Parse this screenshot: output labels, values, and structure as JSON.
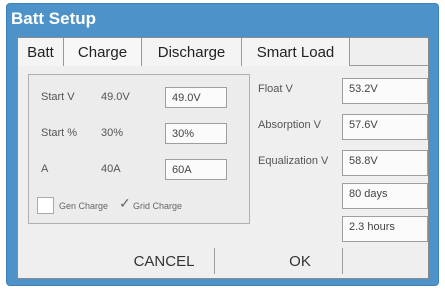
{
  "window": {
    "title": "Batt Setup"
  },
  "tabs": [
    "Batt",
    "Charge",
    "Discharge",
    "Smart Load"
  ],
  "charge": {
    "start_v": {
      "label": "Start V",
      "value": "49.0V",
      "input": "49.0V"
    },
    "start_pct": {
      "label": "Start %",
      "value": "30%",
      "input": "30%"
    },
    "amps": {
      "label": "A",
      "value": "40A",
      "input": "60A"
    },
    "gen_charge_label": "Gen Charge",
    "grid_charge_label": "Grid Charge",
    "gen_charge_checked": false,
    "grid_charge_checked": true
  },
  "voltages": {
    "float": {
      "label": "Float V",
      "value": "53.2V"
    },
    "absorption": {
      "label": "Absorption V",
      "value": "57.6V"
    },
    "equalization": {
      "label": "Equalization V",
      "value": "58.8V"
    },
    "days": {
      "value": "80 days"
    },
    "hours": {
      "value": "2.3 hours"
    }
  },
  "buttons": {
    "cancel": "CANCEL",
    "ok": "OK"
  },
  "colors": {
    "titlebar": "#4d93c9",
    "client": "#efefef"
  }
}
